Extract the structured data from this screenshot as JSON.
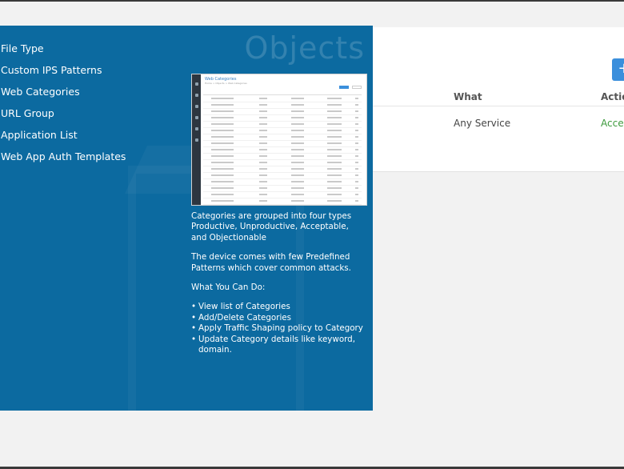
{
  "table": {
    "add_label": "+",
    "columns": {
      "what": "What",
      "action": "Action"
    },
    "row": {
      "what": "Any Service",
      "action": "Accept"
    }
  },
  "panel": {
    "title": "Objects",
    "menu": [
      "File Type",
      "Custom IPS Patterns",
      "Web Categories",
      "URL Group",
      "Application List",
      "Web App Auth Templates"
    ],
    "preview": {
      "title": "Web Categories",
      "breadcrumb": "Home > Objects > Web Categories"
    },
    "description": {
      "p1": "Categories are grouped into four types Productive, Unproductive, Acceptable, and Objectionable",
      "p2": "The device comes with few Predefined Patterns which cover common attacks.",
      "p3": "What You Can Do:",
      "bullets": [
        "View list of Categories",
        "Add/Delete Categories",
        "Apply Traffic Shaping policy to Category",
        "Update Category details like keyword, domain."
      ]
    }
  },
  "colors": {
    "panel_bg": "#0c6aa0",
    "accent": "#3b8fdc",
    "accept_green": "#3c9a3c"
  }
}
